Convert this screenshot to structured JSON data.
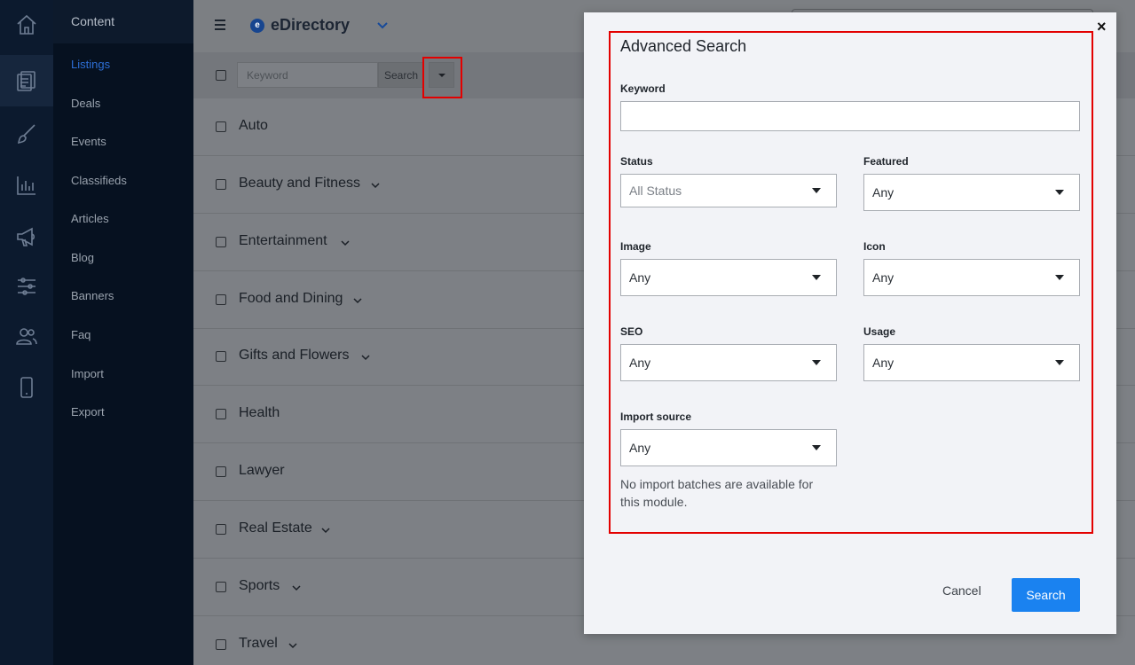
{
  "rail": {
    "icons": [
      "home-icon",
      "content-icon",
      "design-icon",
      "reports-icon",
      "promote-icon",
      "settings-icon",
      "users-icon",
      "mobile-icon"
    ]
  },
  "sidebar": {
    "title": "Content",
    "items": [
      {
        "label": "Listings",
        "active": true
      },
      {
        "label": "Deals"
      },
      {
        "label": "Events"
      },
      {
        "label": "Classifieds"
      },
      {
        "label": "Articles"
      },
      {
        "label": "Blog"
      },
      {
        "label": "Banners"
      },
      {
        "label": "Faq"
      },
      {
        "label": "Import"
      },
      {
        "label": "Export"
      }
    ]
  },
  "header": {
    "brand": "eDirectory",
    "brand_logo": "e"
  },
  "toolbar": {
    "keyword_placeholder": "Keyword",
    "search_label": "Search"
  },
  "categories": [
    {
      "label": "Auto",
      "expandable": false
    },
    {
      "label": "Beauty and Fitness",
      "expandable": true
    },
    {
      "label": "Entertainment",
      "expandable": true
    },
    {
      "label": "Food and Dining",
      "expandable": true
    },
    {
      "label": "Gifts and Flowers",
      "expandable": true
    },
    {
      "label": "Health",
      "expandable": false
    },
    {
      "label": "Lawyer",
      "expandable": false
    },
    {
      "label": "Real Estate",
      "expandable": true
    },
    {
      "label": "Sports",
      "expandable": true
    },
    {
      "label": "Travel",
      "expandable": true
    }
  ],
  "modal": {
    "close": "×",
    "title": "Advanced Search",
    "keyword_label": "Keyword",
    "keyword_value": "",
    "status_label": "Status",
    "status_value": "All Status",
    "featured_label": "Featured",
    "featured_value": "Any",
    "image_label": "Image",
    "image_value": "Any",
    "icon_label": "Icon",
    "icon_value": "Any",
    "seo_label": "SEO",
    "seo_value": "Any",
    "usage_label": "Usage",
    "usage_value": "Any",
    "import_label": "Import source",
    "import_value": "Any",
    "note": "No import batches are available for this module.",
    "cancel_label": "Cancel",
    "search_label": "Search"
  },
  "colors": {
    "accent": "#1a82f0",
    "highlight": "#e30000",
    "sidebar_active": "#2d6fd6"
  }
}
